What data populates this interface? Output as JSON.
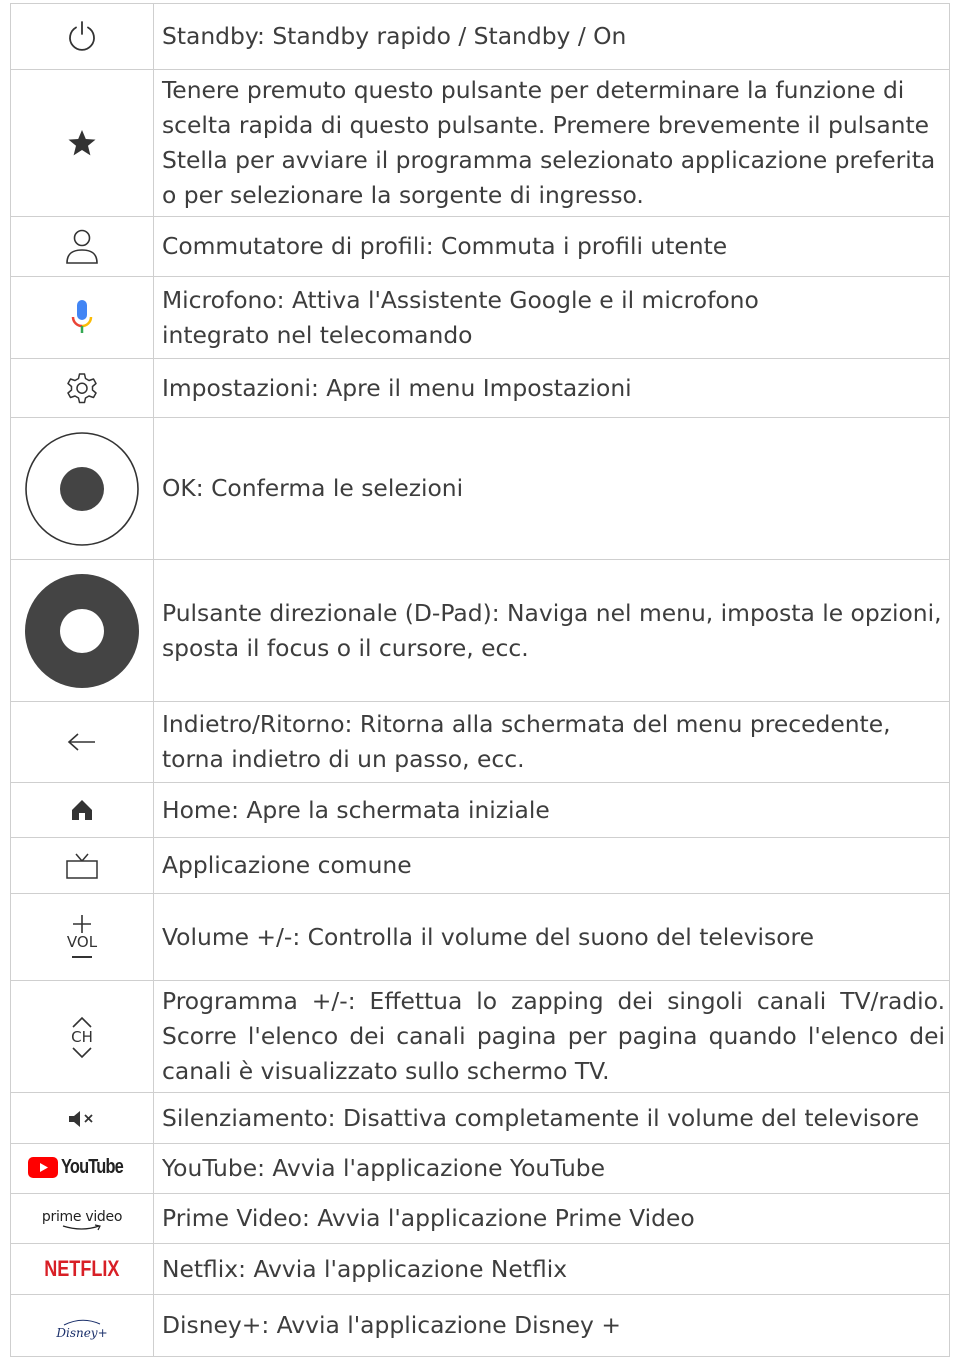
{
  "rows": [
    {
      "icon": "power-icon",
      "text": "Standby: Standby rapido / Standby / On"
    },
    {
      "icon": "star-icon",
      "text": "Tenere premuto questo pulsante per determinare la funzione di scelta rapida di questo pulsante. Premere brevemente il pulsante Stella per avviare il programma selezionato applicazione preferita o per selezionare la sorgente di ingresso."
    },
    {
      "icon": "profile-icon",
      "text": "Commutatore di profili: Commuta i profili utente"
    },
    {
      "icon": "microphone-icon",
      "text": "Microfono: Attiva l'Assistente Google e il microfono integrato nel telecomando"
    },
    {
      "icon": "gear-icon",
      "text": "Impostazioni: Apre il menu Impostazioni"
    },
    {
      "icon": "ok-button-icon",
      "text": "OK: Conferma le selezioni"
    },
    {
      "icon": "dpad-icon",
      "text": "Pulsante direzionale (D-Pad): Naviga nel menu, imposta le opzioni, sposta il focus o il cursore, ecc."
    },
    {
      "icon": "back-arrow-icon",
      "text": "Indietro/Ritorno: Ritorna alla schermata del menu precedente, torna indietro di un passo, ecc."
    },
    {
      "icon": "home-icon",
      "text": "Home: Apre la schermata iniziale"
    },
    {
      "icon": "tv-icon",
      "text": "Applicazione comune"
    },
    {
      "icon": "volume-icon",
      "label": "VOL",
      "text": "Volume +/-: Controlla il volume del suono del televisore"
    },
    {
      "icon": "channel-icon",
      "label": "CH",
      "text": "Programma +/-: Effettua lo zapping dei singoli canali TV/radio. Scorre l'elenco dei canali pagina per pagina quando l'elenco dei canali è visualizzato sullo schermo TV."
    },
    {
      "icon": "mute-icon",
      "text": "Silenziamento: Disattiva completamente il volume del televisore"
    },
    {
      "icon": "youtube-logo",
      "label": "YouTube",
      "text": "YouTube: Avvia l'applicazione YouTube"
    },
    {
      "icon": "prime-video-logo",
      "label": "prime video",
      "text": "Prime Video: Avvia l'applicazione Prime Video"
    },
    {
      "icon": "netflix-logo",
      "label": "NETFLIX",
      "text": "Netflix: Avvia l'applicazione Netflix"
    },
    {
      "icon": "disney-plus-logo",
      "label": "Disney+",
      "text": "Disney+: Avvia l'applicazione Disney +"
    }
  ],
  "colors": {
    "youtube_red": "#ff0000",
    "netflix_red": "#d81f26",
    "mic_blue": "#4285f4",
    "mic_red": "#ea4335",
    "mic_yellow": "#fbbc05",
    "mic_green": "#34a853",
    "dpad_dark": "#444444"
  }
}
